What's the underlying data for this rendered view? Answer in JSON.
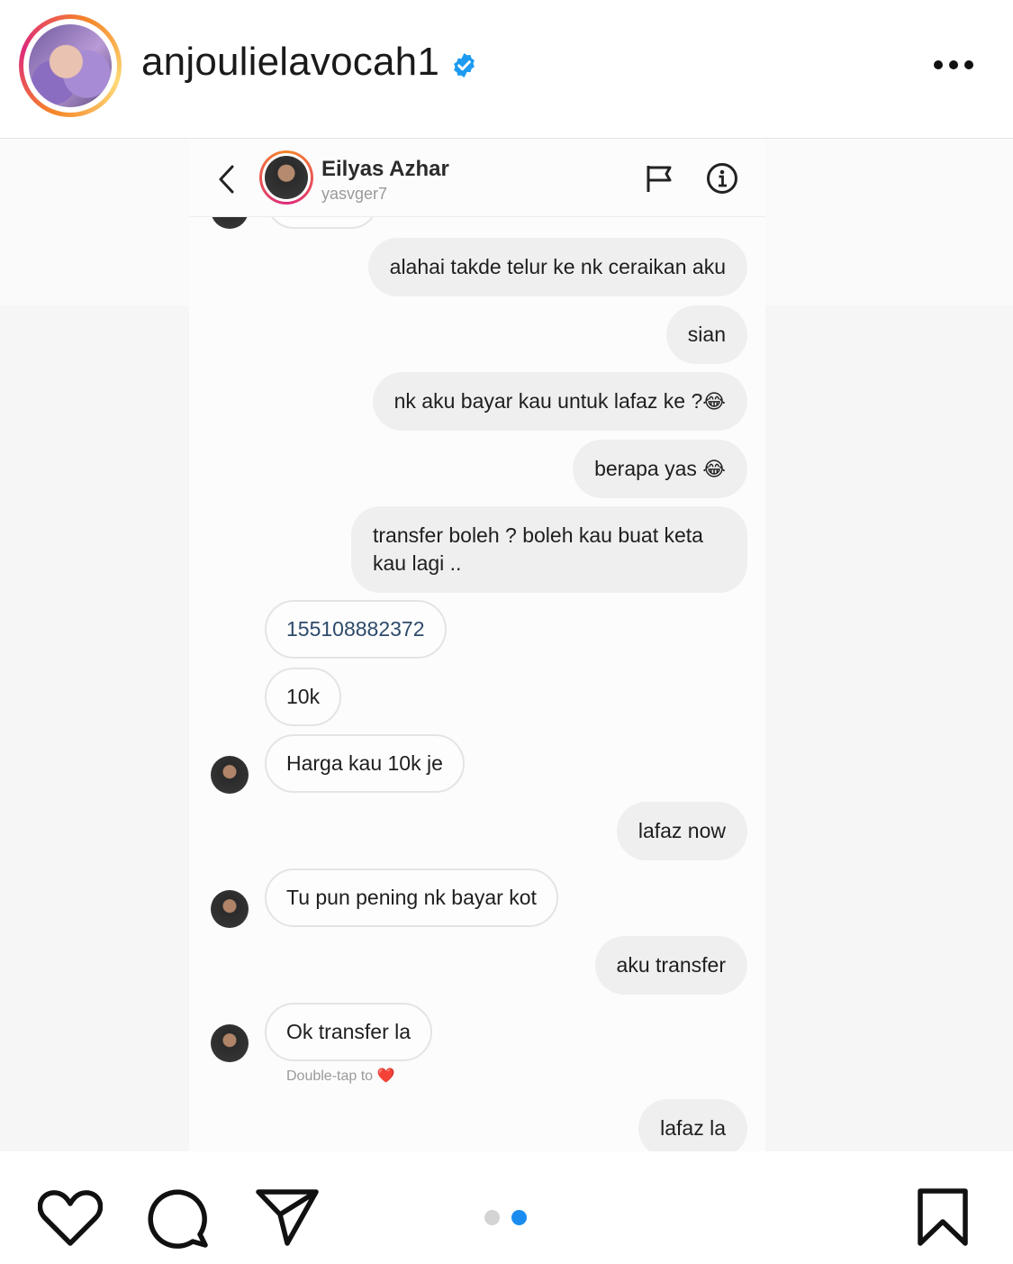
{
  "post": {
    "username": "anjoulielavocah1",
    "verified": true,
    "avatar_icon": "profile-photo",
    "more_icon": "more-horizontal-icon"
  },
  "chat": {
    "contact_name": "Eilyas Azhar",
    "contact_handle": "yasvger7",
    "messages": [
      {
        "dir": "out",
        "text": "alahai takde telur ke nk ceraikan aku"
      },
      {
        "dir": "out",
        "text": "sian"
      },
      {
        "dir": "out",
        "text": "nk aku bayar kau untuk lafaz ke ?",
        "emoji": "😂"
      },
      {
        "dir": "out",
        "text": "berapa yas",
        "emoji": "😂"
      },
      {
        "dir": "out",
        "text": "transfer boleh ? boleh kau buat keta kau lagi .."
      },
      {
        "dir": "in",
        "text": "155108882372"
      },
      {
        "dir": "in",
        "text": "10k"
      },
      {
        "dir": "in",
        "text": "Harga kau 10k je"
      },
      {
        "dir": "out",
        "text": "lafaz now"
      },
      {
        "dir": "in",
        "text": "Tu pun pening nk bayar kot"
      },
      {
        "dir": "out",
        "text": "aku transfer"
      },
      {
        "dir": "in",
        "text": "Ok transfer la"
      },
      {
        "dir": "out",
        "text": "lafaz la"
      }
    ],
    "double_tap_hint": "Double-tap to",
    "double_tap_emoji": "❤️"
  },
  "carousel": {
    "count": 2,
    "active": 2
  },
  "colors": {
    "accent": "#1a8cf0",
    "verified": "#1d9bf0",
    "bubble_out": "#efefef",
    "bubble_in_border": "#e4e4e4"
  }
}
